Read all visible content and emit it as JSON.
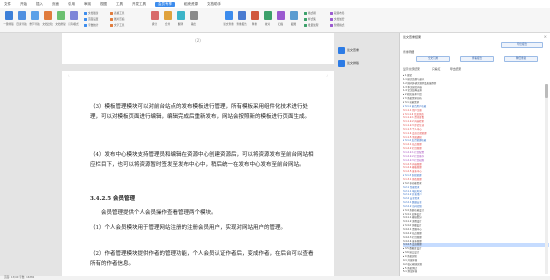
{
  "menu": {
    "items": [
      "文件",
      "开始",
      "插入",
      "页面",
      "引用",
      "审阅",
      "视图",
      "工具",
      "开发工具",
      "会员专享",
      "稻壳资源",
      "文档助手"
    ],
    "active_index": 9
  },
  "toolbar": {
    "big": [
      {
        "label": "一键排版",
        "color": "#3c7fd8"
      },
      {
        "label": "目录导航",
        "color": "#4f8fe0"
      },
      {
        "label": "章节导航",
        "color": "#5aa0e8"
      },
      {
        "label": "文档比较",
        "color": "#e07b3c"
      },
      {
        "label": "文档修复",
        "color": "#6cc070"
      },
      {
        "label": "打印模式",
        "color": "#7d85d8"
      },
      {
        "label": "拆分",
        "color": "#d86a6a"
      },
      {
        "label": "合并",
        "color": "#e0a23c"
      },
      {
        "label": "翻译",
        "color": "#3cb4c8"
      },
      {
        "label": "输出",
        "color": "#8a8a8a"
      },
      {
        "label": "论文查重",
        "color": "#3c8ced"
      },
      {
        "label": "查重报告",
        "color": "#4a7bd0"
      },
      {
        "label": "降重",
        "color": "#d0573c"
      },
      {
        "label": "校对",
        "color": "#3ca06a"
      },
      {
        "label": "扫描",
        "color": "#9b5ad0"
      },
      {
        "label": "截图",
        "color": "#5a9bd0"
      }
    ],
    "small": [
      "文档瘦身",
      "页面设置",
      "字数统计",
      "表格工具",
      "图片压缩",
      "文字工具",
      "格式刷",
      "样式集",
      "批量处理",
      "段落布局",
      "文档加密",
      "智能格式"
    ]
  },
  "page1": {
    "number": "(2)"
  },
  "doc": {
    "p1": "（3）模板管理模块可以对前台站点的发布模板进行管理，所有模板采用组件化技术进行处理，可以对模板页面进行编辑，编辑完成后重新发布，网站会按照新的模板进行页面生成。",
    "p2": "（4）发布中心模块支持管理员和编辑在资源中心创建资源后，可以将资源发布至前台网站相应栏目下，也可以将资源暂时签发至发布中心中，稍后统一在发布中心发布至前台网站。",
    "h": "3.4.2.5 会员管理",
    "p3": "会员管理提供个人会员操作查看管理两个模块。",
    "p4": "（1）个人会员模块用于管理网站注册的注册会员用户，实现对网站用户的管理。",
    "p5": "（2）作者管理模块提供作者的管理功能，个人会员认证作者后，变成作者，在后台可以查看所有的作者信息。"
  },
  "side": {
    "items": [
      "论文查重",
      "论文排版"
    ]
  },
  "panel": {
    "title": "论文查重结果",
    "close": "×",
    "btn_top": "导出报告",
    "section_label": "查重明细",
    "btn1": "全文引用",
    "btn2": "查看报告",
    "btn3": "降低重复",
    "opt1": "显示全部结果",
    "opt2": "只看红",
    "opt3": "导出结果",
    "tree": [
      {
        "t": "▸ 1 绪论",
        "c": ""
      },
      {
        "t": "  1.1 研究背景与意义",
        "c": ""
      },
      {
        "t": "  1.2 国内外研究现状及发展趋势",
        "c": ""
      },
      {
        "t": "  1.3 本文研究内容",
        "c": ""
      },
      {
        "t": "  1.4 论文结构安排",
        "c": ""
      },
      {
        "t": "▸ 2 相关技术介绍",
        "c": ""
      },
      {
        "t": "▾ 3 系统需求分析",
        "c": ""
      },
      {
        "t": "  ▾ 3.1 功能需求",
        "c": ""
      },
      {
        "t": "    ▾ 3.1.1 前台用户功能",
        "c": "blu"
      },
      {
        "t": "      3.1.1.1 用户注册",
        "c": "red"
      },
      {
        "t": "      ▾ 3.1.1.2 信息浏览",
        "c": "red"
      },
      {
        "t": "        3.1.1.2.1 资讯查看",
        "c": "red"
      },
      {
        "t": "        3.1.1.2.2 内容检索",
        "c": "red"
      },
      {
        "t": "        3.1.1.2.3 评论互动",
        "c": "red"
      },
      {
        "t": "      3.1.1.3 个人中心",
        "c": "red"
      },
      {
        "t": "      3.1.1.4 会员订阅管理",
        "c": "red"
      },
      {
        "t": "      3.1.1.5 消息通知",
        "c": "red"
      },
      {
        "t": "    ▾ 3.1.2 后台管理功能",
        "c": "blu"
      },
      {
        "t": "      3.1.2.1 站点管理",
        "c": "red"
      },
      {
        "t": "      3.1.2.2 栏目管理",
        "c": "red"
      },
      {
        "t": "        3.1.2.2.1 栏目配置",
        "c": "pur"
      },
      {
        "t": "        3.1.2.2.2 栏目排序",
        "c": "pur"
      },
      {
        "t": "        3.1.2.2.3 栏目权限",
        "c": "pur"
      },
      {
        "t": "      3.1.2.3 内容管理",
        "c": "red"
      },
      {
        "t": "      3.1.2.4 模板管理",
        "c": "red"
      },
      {
        "t": "      3.1.2.5 发布中心",
        "c": "red"
      },
      {
        "t": "    ▾ 3.1.3 系统管理",
        "c": "blu"
      },
      {
        "t": "      3.1.3.1 角色管理",
        "c": "red"
      },
      {
        "t": "    ▾ 3.2 非功能需求",
        "c": ""
      },
      {
        "t": "      3.2.1 性能需求",
        "c": "blu"
      },
      {
        "t": "        3.2.1.1 响应时间",
        "c": "blu"
      },
      {
        "t": "        3.2.1.2 并发用户",
        "c": "blu"
      },
      {
        "t": "      3.2.2 安全需求",
        "c": "blu"
      },
      {
        "t": "        3.2.2.1 数据安全",
        "c": "blu"
      },
      {
        "t": "        3.2.2.2 访问控制",
        "c": "blu"
      },
      {
        "t": "  ▾ 3.4 系统功能设计",
        "c": ""
      },
      {
        "t": "    ▾ 3.4.1 总体设计",
        "c": ""
      },
      {
        "t": "      3.4.1.1 模块划分",
        "c": ""
      },
      {
        "t": "      3.4.1.2 流程设计",
        "c": ""
      },
      {
        "t": "    ▾ 3.4.2 详细设计",
        "c": ""
      },
      {
        "t": "      3.4.2.1 资源中心",
        "c": ""
      },
      {
        "t": "      3.4.2.2 站点管理",
        "c": ""
      },
      {
        "t": "      3.4.2.3 栏目管理",
        "c": ""
      },
      {
        "t": "      3.4.2.4 发布管理",
        "c": ""
      },
      {
        "t": "      3.4.2.5 会员管理",
        "c": "sel"
      },
      {
        "t": "  ▸ 3.5 数据库设计",
        "c": ""
      },
      {
        "t": "  ▸ 3.6 接口设计",
        "c": ""
      },
      {
        "t": "▸ 4 系统实现",
        "c": ""
      },
      {
        "t": "  4.1 开发环境",
        "c": ""
      },
      {
        "t": "  4.2 核心模块实现",
        "c": ""
      },
      {
        "t": "▸ 5 系统测试",
        "c": ""
      },
      {
        "t": "  5.1 测试环境",
        "c": ""
      }
    ]
  },
  "status": {
    "text": "页面: 13/40  字数: 16382"
  }
}
